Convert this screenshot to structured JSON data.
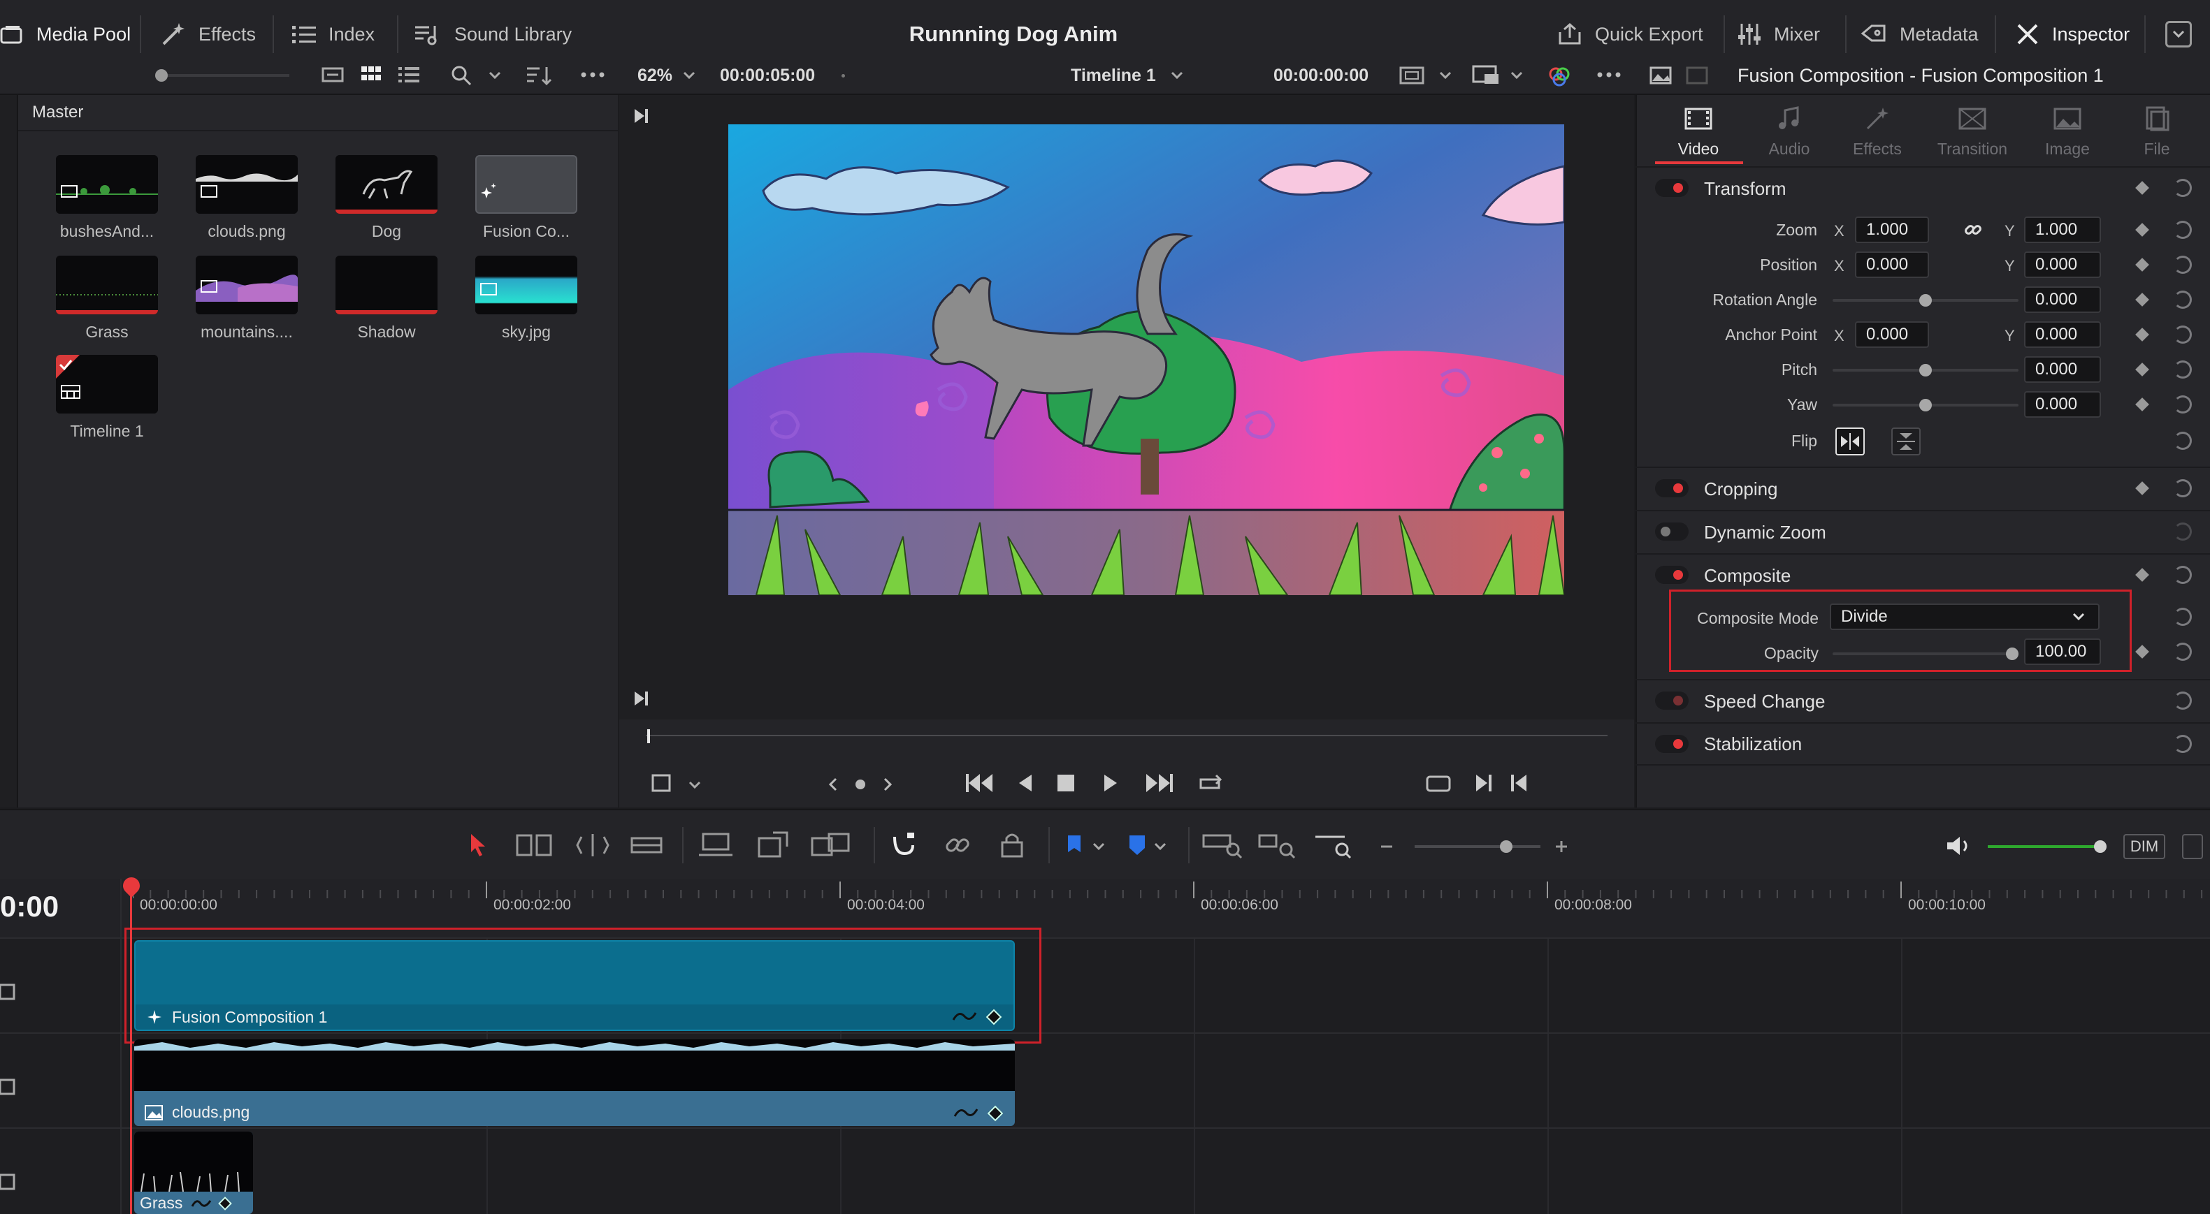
{
  "app": {
    "project_title": "Runnning Dog Anim"
  },
  "topbar": {
    "left": [
      {
        "label": "Media Pool",
        "icon": "media-pool-icon"
      },
      {
        "label": "Effects",
        "icon": "effects-wand-icon"
      },
      {
        "label": "Index",
        "icon": "index-list-icon"
      },
      {
        "label": "Sound Library",
        "icon": "sound-library-icon"
      }
    ],
    "right": [
      {
        "label": "Quick Export",
        "icon": "export-icon"
      },
      {
        "label": "Mixer",
        "icon": "mixer-icon"
      },
      {
        "label": "Metadata",
        "icon": "metadata-icon"
      },
      {
        "label": "Inspector",
        "icon": "inspector-icon"
      }
    ]
  },
  "viewer_bar": {
    "zoom": "62%",
    "duration": "00:00:05:00",
    "timeline_name": "Timeline 1",
    "timecode": "00:00:00:00",
    "inspector_title": "Fusion Composition - Fusion Composition 1"
  },
  "media_pool": {
    "folder": "Master",
    "clips": [
      {
        "name": "bushesAnd...",
        "kind": "image"
      },
      {
        "name": "clouds.png",
        "kind": "image"
      },
      {
        "name": "Dog",
        "kind": "video"
      },
      {
        "name": "Fusion Co...",
        "kind": "fusion"
      },
      {
        "name": "Grass",
        "kind": "video"
      },
      {
        "name": "mountains....",
        "kind": "image"
      },
      {
        "name": "Shadow",
        "kind": "video"
      },
      {
        "name": "sky.jpg",
        "kind": "image"
      },
      {
        "name": "Timeline 1",
        "kind": "timeline"
      }
    ]
  },
  "inspector": {
    "tabs": [
      {
        "label": "Video",
        "active": true
      },
      {
        "label": "Audio",
        "active": false
      },
      {
        "label": "Effects",
        "active": false
      },
      {
        "label": "Transition",
        "active": false
      },
      {
        "label": "Image",
        "active": false
      },
      {
        "label": "File",
        "active": false
      }
    ],
    "transform": {
      "title": "Transform",
      "zoom_label": "Zoom",
      "zoom_x": "1.000",
      "zoom_y": "1.000",
      "position_label": "Position",
      "position_x": "0.000",
      "position_y": "0.000",
      "rotation_label": "Rotation Angle",
      "rotation": "0.000",
      "anchor_label": "Anchor Point",
      "anchor_x": "0.000",
      "anchor_y": "0.000",
      "pitch_label": "Pitch",
      "pitch": "0.000",
      "yaw_label": "Yaw",
      "yaw": "0.000",
      "flip_label": "Flip",
      "x_axis": "X",
      "y_axis": "Y"
    },
    "cropping": {
      "title": "Cropping"
    },
    "dynamic_zoom": {
      "title": "Dynamic Zoom"
    },
    "composite": {
      "title": "Composite",
      "mode_label": "Composite Mode",
      "mode_value": "Divide",
      "opacity_label": "Opacity",
      "opacity_value": "100.00",
      "opacity_level": 1.0
    },
    "speed_change": {
      "title": "Speed Change"
    },
    "stabilization": {
      "title": "Stabilization"
    }
  },
  "timeline_toolbar": {
    "dim_label": "DIM"
  },
  "timeline": {
    "current_timecode": "0:00",
    "ruler": [
      "00:00:00:00",
      "00:00:02:00",
      "00:00:04:00",
      "00:00:06:00",
      "00:00:08:00",
      "00:00:10:00"
    ],
    "clips": [
      {
        "name": "Fusion Composition 1",
        "icon": "fusion-sparkle-icon"
      },
      {
        "name": "clouds.png",
        "icon": "image-icon"
      },
      {
        "name": "Grass",
        "icon": ""
      }
    ]
  },
  "colors": {
    "accent_red": "#e8393c",
    "fusion_clip": "#0b6e8e",
    "image_clip": "#3a6f92",
    "highlight_box": "#d0212a"
  }
}
